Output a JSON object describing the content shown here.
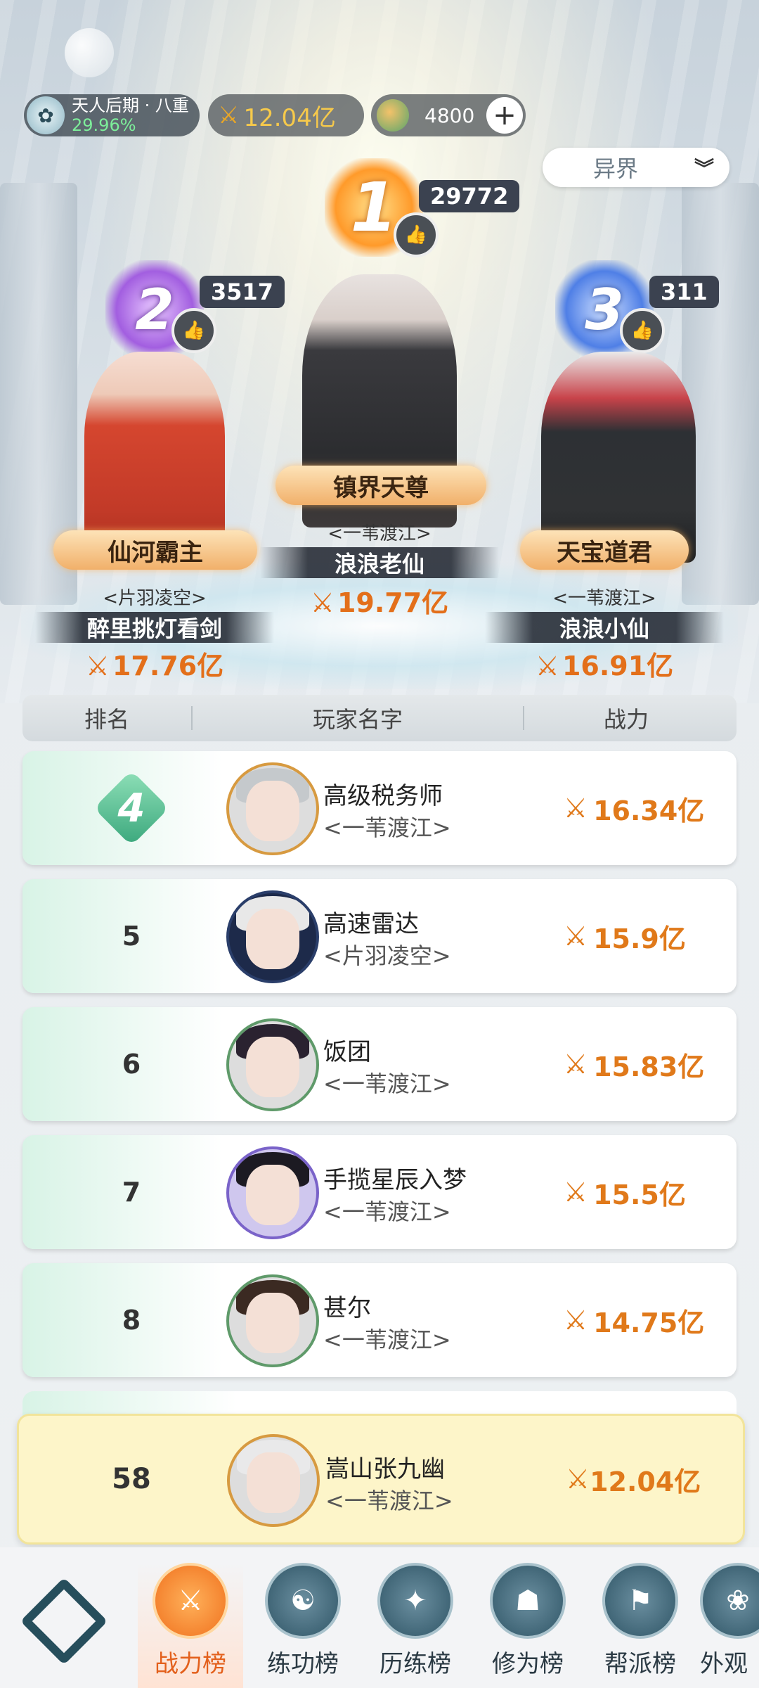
{
  "header": {
    "realm": {
      "label": "天人后期 · 八重",
      "percent": "29.96%"
    },
    "power": "12.04亿",
    "jade": "4800",
    "plus_label": "+",
    "server_select": "异界"
  },
  "podium": [
    {
      "rank": "1",
      "likes": "29772",
      "title": "镇界天尊",
      "guild": "<一苇渡江>",
      "name": "浪浪老仙",
      "power": "19.77亿"
    },
    {
      "rank": "2",
      "likes": "3517",
      "title": "仙河霸主",
      "guild": "<片羽凌空>",
      "name": "醉里挑灯看剑",
      "power": "17.76亿"
    },
    {
      "rank": "3",
      "likes": "311",
      "title": "天宝道君",
      "guild": "<一苇渡江>",
      "name": "浪浪小仙",
      "power": "16.91亿"
    }
  ],
  "table": {
    "headers": [
      "排名",
      "玩家名字",
      "战力"
    ],
    "rows": [
      {
        "rank": "4",
        "name": "高级税务师",
        "guild": "<一苇渡江>",
        "power": "16.34亿"
      },
      {
        "rank": "5",
        "name": "高速雷达",
        "guild": "<片羽凌空>",
        "power": "15.9亿"
      },
      {
        "rank": "6",
        "name": "饭团",
        "guild": "<一苇渡江>",
        "power": "15.83亿"
      },
      {
        "rank": "7",
        "name": "手揽星辰入梦",
        "guild": "<一苇渡江>",
        "power": "15.5亿"
      },
      {
        "rank": "8",
        "name": "甚尔",
        "guild": "<一苇渡江>",
        "power": "14.75亿"
      }
    ],
    "self": {
      "rank": "58",
      "name": "嵩山张九幽",
      "guild": "<一苇渡江>",
      "power": "12.04亿"
    }
  },
  "nav": {
    "items": [
      "战力榜",
      "练功榜",
      "历练榜",
      "修为榜",
      "帮派榜",
      "外观"
    ],
    "active": "战力榜"
  },
  "colors": {
    "accent": "#e0791a",
    "active_tab": "#e3601c",
    "self_row": "#fdf5c9"
  },
  "icons": {
    "thumb": "thumbs-up-icon",
    "sword": "crossed-swords-icon",
    "chevron": "chevron-down-icon"
  }
}
